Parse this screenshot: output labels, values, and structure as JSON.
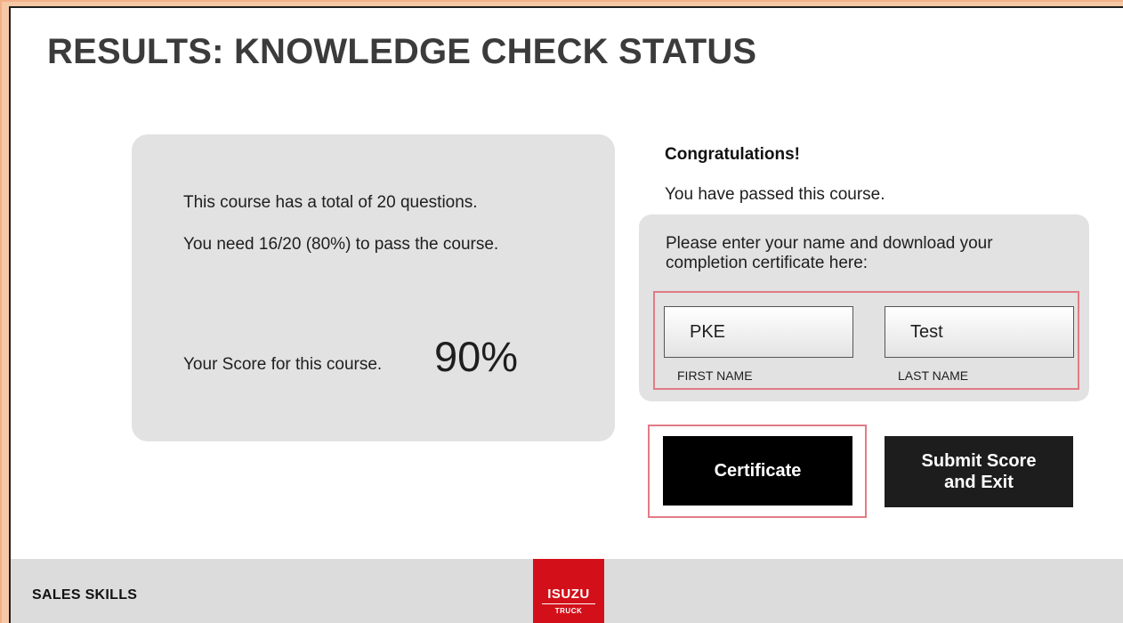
{
  "page": {
    "title": "RESULTS: KNOWLEDGE CHECK STATUS"
  },
  "score_panel": {
    "total_line": "This course has a total of 20 questions.",
    "pass_line": "You need 16/20 (80%) to pass the course.",
    "score_label": "Your Score for this course.",
    "score_value": "90%"
  },
  "result": {
    "congrats": "Congratulations!",
    "passed": "You have passed this course."
  },
  "name_form": {
    "prompt": "Please enter your name and download your completion certificate here:",
    "first_name_value": "PKE",
    "last_name_value": "Test",
    "first_name_label": "FIRST NAME",
    "last_name_label": "LAST NAME"
  },
  "buttons": {
    "certificate": "Certificate",
    "submit_line1": "Submit Score",
    "submit_line2": "and Exit"
  },
  "footer": {
    "course_name": "SALES SKILLS",
    "logo_text": "ISUZU",
    "logo_sub": "TRUCK"
  },
  "colors": {
    "highlight_outline": "#e27b86",
    "logo_red": "#d3101a",
    "panel_gray": "#e2e2e2"
  }
}
